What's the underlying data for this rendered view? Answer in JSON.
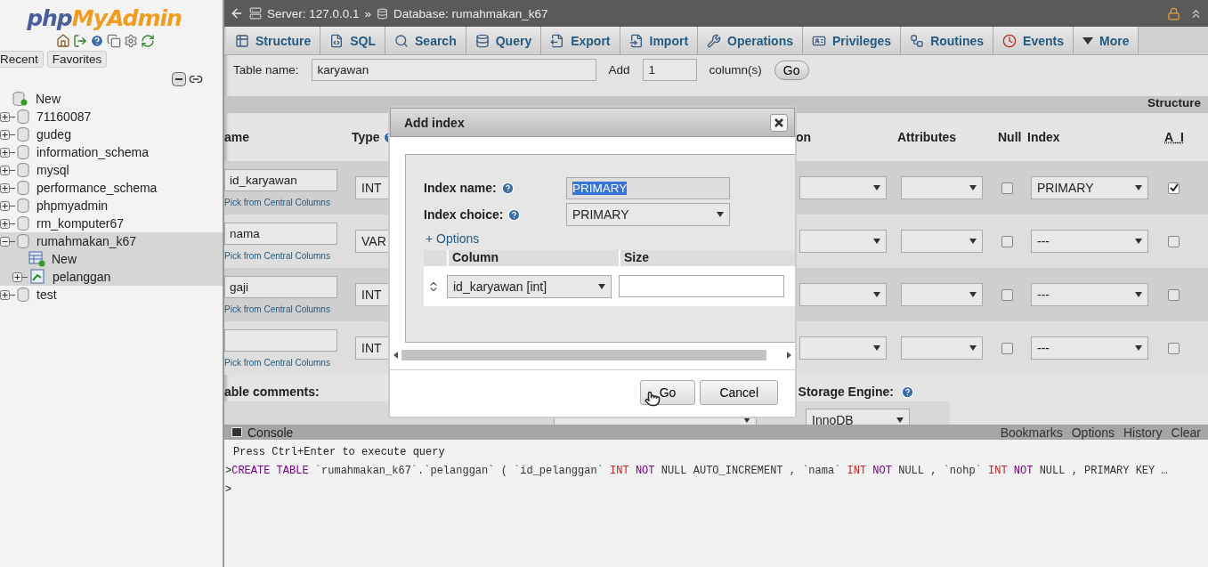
{
  "sidebar": {
    "logo_php": "php",
    "logo_rest": "MyAdmin",
    "tabs": [
      {
        "label": "Recent"
      },
      {
        "label": "Favorites"
      }
    ],
    "tree": [
      {
        "label": "New",
        "kind": "new",
        "selected": false
      },
      {
        "label": "71160087",
        "kind": "db",
        "expanded": false,
        "selected": false
      },
      {
        "label": "gudeg",
        "kind": "db",
        "expanded": false,
        "selected": false
      },
      {
        "label": "information_schema",
        "kind": "db",
        "expanded": false,
        "selected": false
      },
      {
        "label": "mysql",
        "kind": "db",
        "expanded": false,
        "selected": false
      },
      {
        "label": "performance_schema",
        "kind": "db",
        "expanded": false,
        "selected": false
      },
      {
        "label": "phpmyadmin",
        "kind": "db",
        "expanded": false,
        "selected": false
      },
      {
        "label": "rm_komputer67",
        "kind": "db",
        "expanded": false,
        "selected": false
      },
      {
        "label": "rumahmakan_k67",
        "kind": "db",
        "expanded": true,
        "selected": true,
        "children": [
          {
            "label": "New",
            "kind": "new-table"
          },
          {
            "label": "pelanggan",
            "kind": "table",
            "expanded": false
          }
        ]
      },
      {
        "label": "test",
        "kind": "db",
        "expanded": false,
        "selected": false
      }
    ]
  },
  "breadcrumb": {
    "server": "Server: 127.0.0.1",
    "separator": "»",
    "database": "Database: rumahmakan_k67"
  },
  "tabs": [
    {
      "label": "Structure",
      "kind": "structure",
      "selected": false
    },
    {
      "label": "SQL",
      "kind": "sql",
      "selected": false
    },
    {
      "label": "Search",
      "kind": "search",
      "selected": false
    },
    {
      "label": "Query",
      "kind": "query",
      "selected": false
    },
    {
      "label": "Export",
      "kind": "export",
      "selected": false
    },
    {
      "label": "Import",
      "kind": "import",
      "selected": false
    },
    {
      "label": "Operations",
      "kind": "operations",
      "selected": false
    },
    {
      "label": "Privileges",
      "kind": "privileges",
      "selected": false
    },
    {
      "label": "Routines",
      "kind": "routines",
      "selected": false
    },
    {
      "label": "Events",
      "kind": "events",
      "selected": false
    },
    {
      "label": "More",
      "kind": "more",
      "selected": false
    }
  ],
  "table_name_row": {
    "label": "Table name:",
    "value": "karyawan",
    "add_label": "Add",
    "add_value": "1",
    "columns_label": "column(s)",
    "go": "Go"
  },
  "structure_bar": "Structure",
  "headers": {
    "name": "ame",
    "type": "Type",
    "collation": "on",
    "attributes": "Attributes",
    "null": "Null",
    "index": "Index",
    "ai": "A_I"
  },
  "rows": [
    {
      "name": "id_karyawan",
      "link": "Pick from Central Columns",
      "type": "INT",
      "null_checked": false,
      "index": "PRIMARY",
      "ai_checked": true
    },
    {
      "name": "nama",
      "link": "Pick from Central Columns",
      "type": "VAR",
      "null_checked": false,
      "index": "---",
      "ai_checked": false
    },
    {
      "name": "gaji",
      "link": "Pick from Central Columns",
      "type": "INT",
      "null_checked": false,
      "index": "---",
      "ai_checked": false
    },
    {
      "link": "Pick from Central Columns",
      "type": "INT",
      "null_checked": false,
      "index": "---",
      "ai_checked": false
    }
  ],
  "footer": {
    "comments_label": "able comments:",
    "engine_label": "Storage Engine:",
    "engine": "InnoDB"
  },
  "dialog": {
    "title": "Add index",
    "index_name_label": "Index name:",
    "index_name": "PRIMARY",
    "index_choice_label": "Index choice:",
    "index_choice": "PRIMARY",
    "options_link": "+ Options",
    "column_header": "Column",
    "size_header": "Size",
    "column_value": "id_karyawan [int]",
    "go": "Go",
    "cancel": "Cancel"
  },
  "console": {
    "title": "Console",
    "links": [
      "Bookmarks",
      "Options",
      "History",
      "Clear"
    ],
    "hint": "Press Ctrl+Enter to execute query",
    "prompt": ">",
    "query": [
      {
        "text": "CREATE TABLE",
        "kind": "keyword"
      },
      {
        "text": " `rumahmakan_k67`.`pelanggan` ( `id_pelanggan` ",
        "kind": "plain"
      },
      {
        "text": "INT",
        "kind": "type"
      },
      {
        "text": " NOT",
        "kind": "keyword"
      },
      {
        "text": " NULL AUTO_INCREMENT , `nama` ",
        "kind": "plain"
      },
      {
        "text": "INT",
        "kind": "type"
      },
      {
        "text": " NOT",
        "kind": "keyword"
      },
      {
        "text": " NULL , `nohp` ",
        "kind": "plain"
      },
      {
        "text": "INT",
        "kind": "type"
      },
      {
        "text": " NOT",
        "kind": "keyword"
      },
      {
        "text": " NULL , PRIMARY KEY …",
        "kind": "plain"
      }
    ],
    "empty_prompt": ">"
  }
}
